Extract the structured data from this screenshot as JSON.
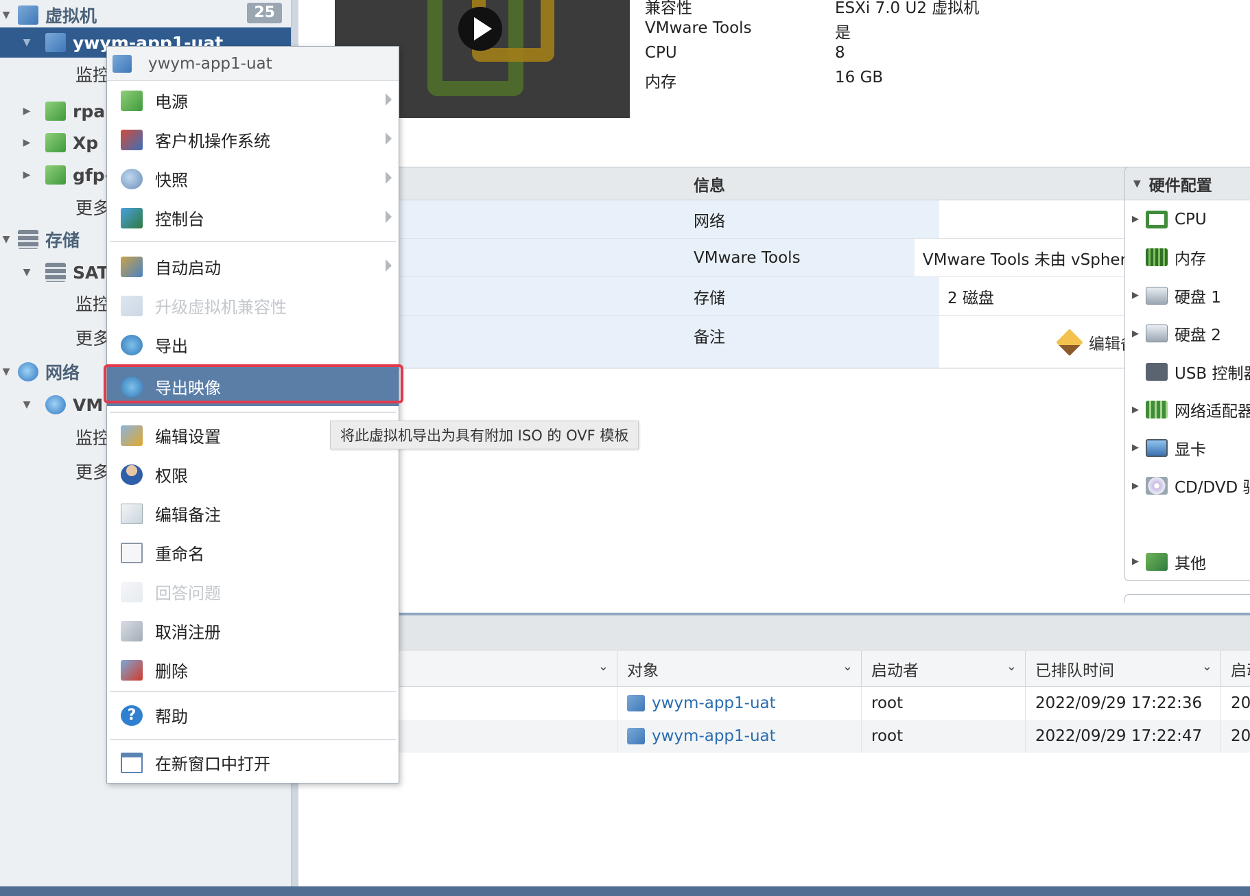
{
  "navigator": {
    "vm_section": {
      "label": "虚拟机",
      "count": "25"
    },
    "vm_selected": "ywym-app1-uat",
    "vm_children": [
      "监控",
      "rpa",
      "Xp",
      "gfp-",
      "更多"
    ],
    "storage_section": "存储",
    "storage_child": "SATA",
    "storage_children": [
      "监控",
      "更多"
    ],
    "network_section": "网络",
    "network_child": "VM",
    "network_children": [
      "监控",
      "更多"
    ]
  },
  "summary": {
    "rows": [
      {
        "key": "兼容性",
        "value": "ESXi 7.0 U2 虚拟机"
      },
      {
        "key": "VMware Tools",
        "value": "是"
      },
      {
        "key": "CPU",
        "value": "8"
      },
      {
        "key": "内存",
        "value": "16 GB"
      }
    ]
  },
  "info_panel": {
    "title": "信息",
    "rows": [
      {
        "key": "网络",
        "value": ""
      },
      {
        "key": "VMware Tools",
        "value": "VMware Tools 未由 vSphere 管理"
      },
      {
        "key": "存储",
        "value": "2 磁盘"
      },
      {
        "key": "备注",
        "value": ""
      }
    ],
    "edit_notes_label": "编辑备注"
  },
  "hardware_panel": {
    "title": "硬件配置",
    "items": [
      {
        "label": "CPU",
        "icon": "cpu-icon"
      },
      {
        "label": "内存",
        "icon": "memory-icon"
      },
      {
        "label": "硬盘 1",
        "icon": "hard-disk-icon"
      },
      {
        "label": "硬盘 2",
        "icon": "hard-disk-icon"
      },
      {
        "label": "USB 控制器",
        "icon": "usb-icon"
      },
      {
        "label": "网络适配器",
        "icon": "network-adapter-icon"
      },
      {
        "label": "显卡",
        "icon": "display-icon"
      },
      {
        "label": "CD/DVD 驱",
        "icon": "cd-dvd-icon"
      },
      {
        "label": "其他",
        "icon": "other-hardware-icon"
      }
    ]
  },
  "tasks": {
    "columns": [
      "",
      "对象",
      "启动者",
      "已排队时间",
      "启动"
    ],
    "rows": [
      {
        "object": "ywym-app1-uat",
        "initiator": "root",
        "queued": "2022/09/29 17:22:36",
        "started": "20"
      },
      {
        "object": "ywym-app1-uat",
        "initiator": "root",
        "queued": "2022/09/29 17:22:47",
        "started": "20"
      }
    ]
  },
  "context_menu": {
    "title": "ywym-app1-uat",
    "items": [
      {
        "label": "电源",
        "icon": "power-icon",
        "submenu": true,
        "disabled": false
      },
      {
        "label": "客户机操作系统",
        "icon": "guest-os-icon",
        "submenu": true,
        "disabled": false
      },
      {
        "label": "快照",
        "icon": "snapshot-icon",
        "submenu": true,
        "disabled": false
      },
      {
        "label": "控制台",
        "icon": "console-icon",
        "submenu": true,
        "disabled": false
      },
      {
        "label": "自动启动",
        "icon": "autostart-icon",
        "submenu": true,
        "disabled": false
      },
      {
        "label": "升级虚拟机兼容性",
        "icon": "upgrade-icon",
        "submenu": false,
        "disabled": true
      },
      {
        "label": "导出",
        "icon": "export-icon",
        "submenu": false,
        "disabled": false
      },
      {
        "label": "导出映像",
        "icon": "export-image-icon",
        "submenu": false,
        "disabled": false,
        "active": true
      },
      {
        "label": "编辑设置",
        "icon": "edit-settings-icon",
        "submenu": false,
        "disabled": false
      },
      {
        "label": "权限",
        "icon": "permissions-icon",
        "submenu": false,
        "disabled": false
      },
      {
        "label": "编辑备注",
        "icon": "edit-notes-icon",
        "submenu": false,
        "disabled": false
      },
      {
        "label": "重命名",
        "icon": "rename-icon",
        "submenu": false,
        "disabled": false
      },
      {
        "label": "回答问题",
        "icon": "answer-question-icon",
        "submenu": false,
        "disabled": true
      },
      {
        "label": "取消注册",
        "icon": "unregister-icon",
        "submenu": false,
        "disabled": false
      },
      {
        "label": "删除",
        "icon": "delete-icon",
        "submenu": false,
        "disabled": false
      },
      {
        "label": "帮助",
        "icon": "help-icon",
        "submenu": false,
        "disabled": false
      },
      {
        "label": "在新窗口中打开",
        "icon": "new-window-icon",
        "submenu": false,
        "disabled": false
      }
    ]
  },
  "tooltip": "将此虚拟机导出为具有附加 ISO 的 OVF 模板",
  "colors": {
    "accent": "#2f5b8f",
    "menu_active": "#5b7ea7",
    "highlight": "#e23a4d",
    "link": "#2a6db0"
  }
}
